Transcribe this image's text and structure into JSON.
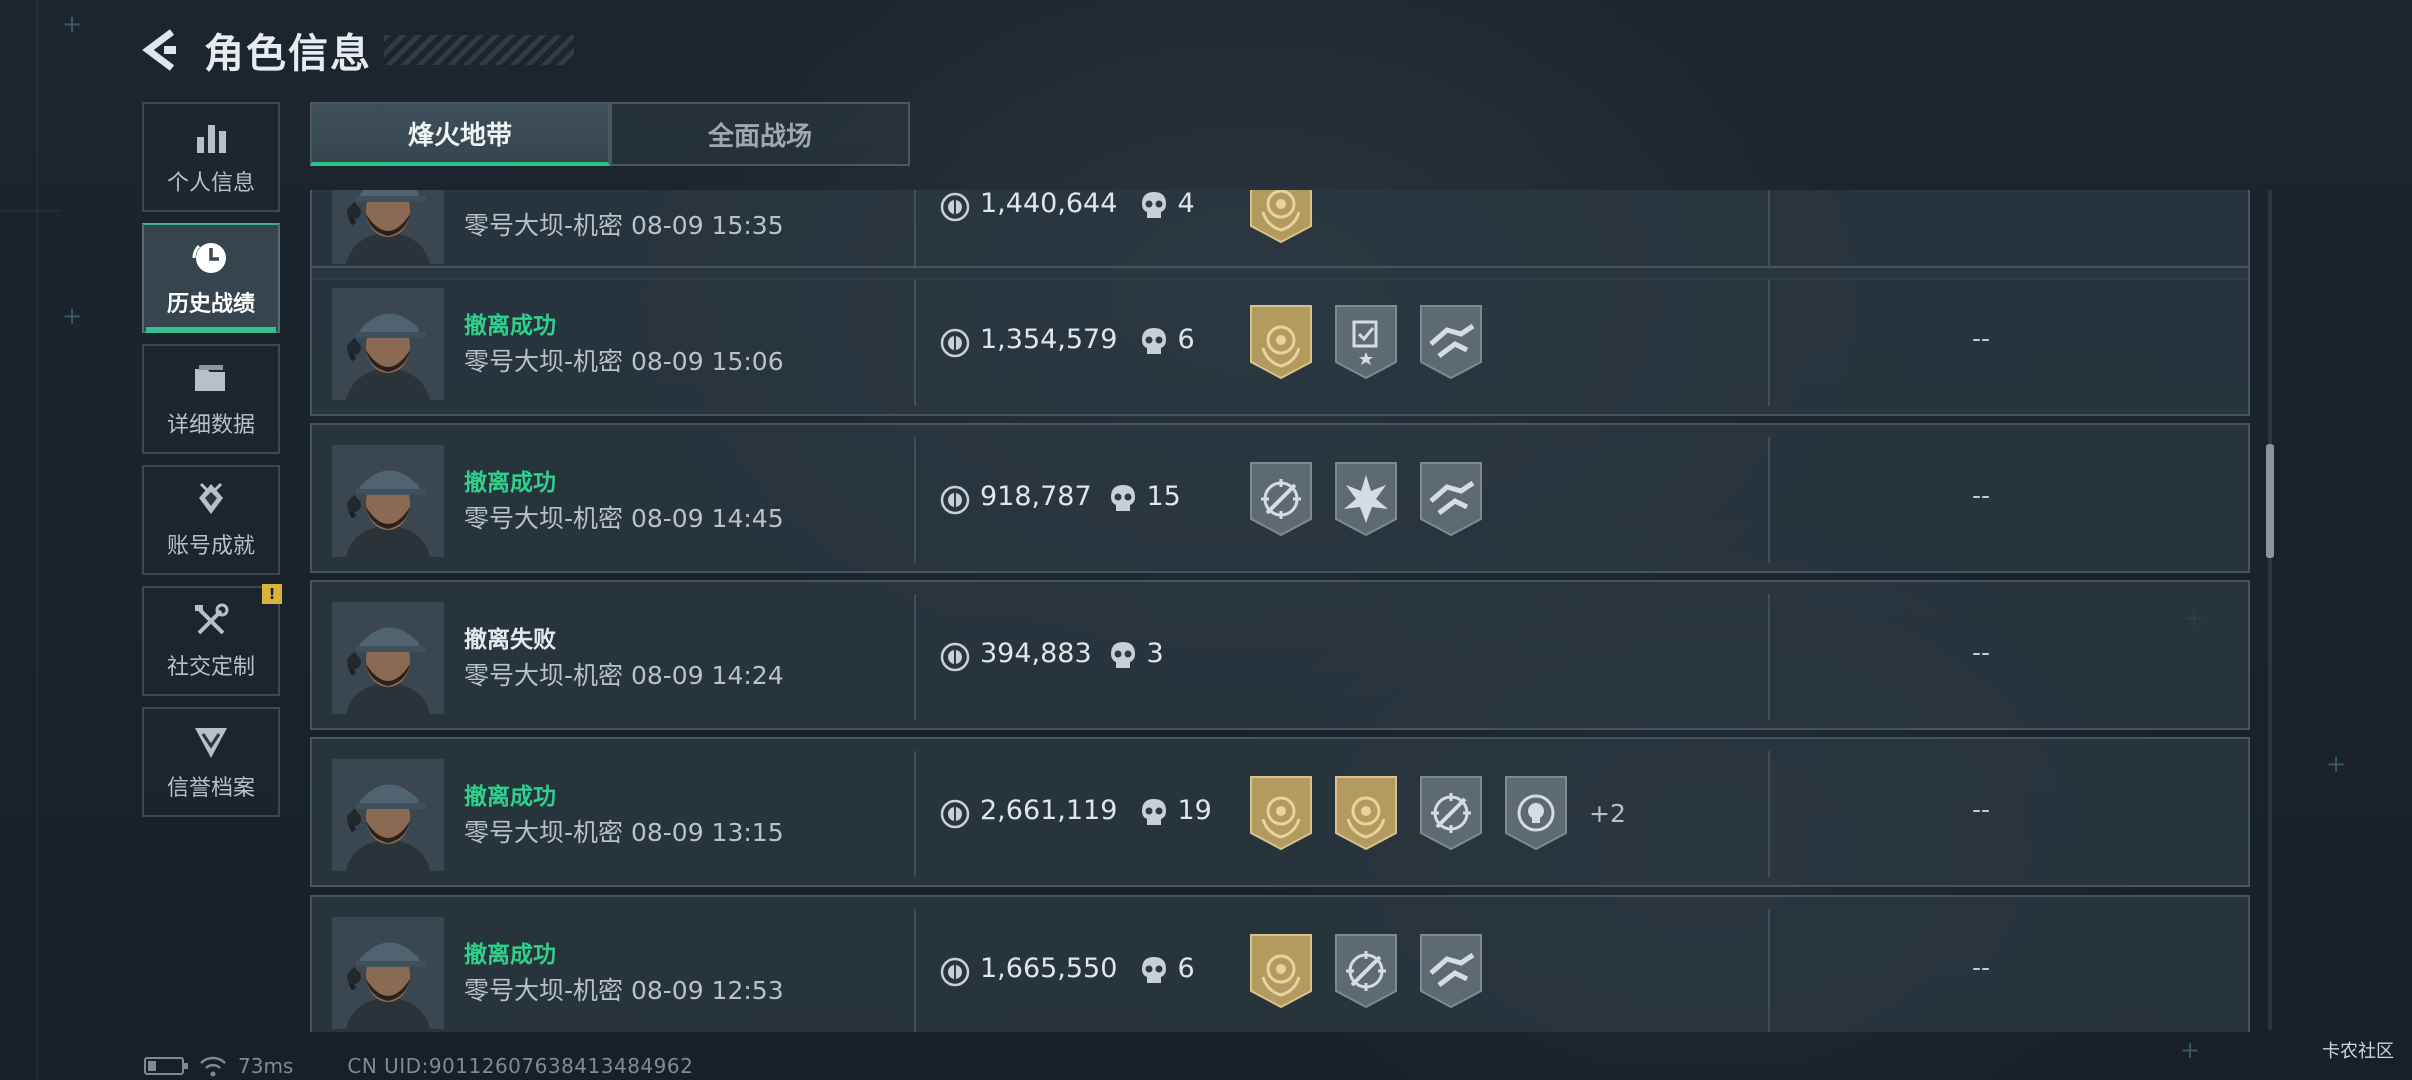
{
  "header": {
    "title": "角色信息"
  },
  "sidebar": {
    "items": [
      {
        "label": "个人信息",
        "icon": "bar-chart-icon",
        "active": false
      },
      {
        "label": "历史战绩",
        "icon": "clock-history-icon",
        "active": true
      },
      {
        "label": "详细数据",
        "icon": "folder-icon",
        "active": false
      },
      {
        "label": "账号成就",
        "icon": "achievement-icon",
        "active": false
      },
      {
        "label": "社交定制",
        "icon": "tools-icon",
        "active": false,
        "alert": "!"
      },
      {
        "label": "信誉档案",
        "icon": "shield-chevron-icon",
        "active": false
      }
    ]
  },
  "tabs": [
    {
      "label": "烽火地带",
      "active": true
    },
    {
      "label": "全面战场",
      "active": false
    }
  ],
  "records": [
    {
      "status": "",
      "status_type": "",
      "map_time": "零号大坝-机密 08-09 15:35",
      "value": "1,440,644",
      "kills": "4",
      "medals": [
        "gold-medal-icon"
      ],
      "more": "",
      "extra": ""
    },
    {
      "status": "撤离成功",
      "status_type": "success",
      "map_time": "零号大坝-机密 08-09 15:06",
      "value": "1,354,579",
      "kills": "6",
      "medals": [
        "gold-medal-icon",
        "checklist-star-badge-icon",
        "handoff-badge-icon"
      ],
      "more": "",
      "extra": "--"
    },
    {
      "status": "撤离成功",
      "status_type": "success",
      "map_time": "零号大坝-机密 08-09 14:45",
      "value": "918,787",
      "kills": "15",
      "medals": [
        "crosshair-rifle-badge-icon",
        "explosion-badge-icon",
        "handoff-badge-icon"
      ],
      "more": "",
      "extra": "--"
    },
    {
      "status": "撤离失败",
      "status_type": "fail",
      "map_time": "零号大坝-机密 08-09 14:24",
      "value": "394,883",
      "kills": "3",
      "medals": [],
      "more": "",
      "extra": "--"
    },
    {
      "status": "撤离成功",
      "status_type": "success",
      "map_time": "零号大坝-机密 08-09 13:15",
      "value": "2,661,119",
      "kills": "19",
      "medals": [
        "gold-medal-icon",
        "gold-medal-icon",
        "crosshair-knife-badge-icon",
        "skull-target-badge-icon"
      ],
      "more": "+2",
      "extra": "--"
    },
    {
      "status": "撤离成功",
      "status_type": "success",
      "map_time": "零号大坝-机密 08-09 12:53",
      "value": "1,665,550",
      "kills": "6",
      "medals": [
        "gold-medal-icon",
        "crosshair-knife-badge-icon",
        "handoff-badge-icon"
      ],
      "more": "",
      "extra": "--"
    }
  ],
  "footer": {
    "latency": "73ms",
    "uid": "CN UID:9011260763841348496​2"
  },
  "watermark": "卡农社区",
  "colors": {
    "accent": "#2ec08a",
    "success": "#2fd08c",
    "gold": "#b39a5e",
    "alert": "#d9b33c"
  }
}
